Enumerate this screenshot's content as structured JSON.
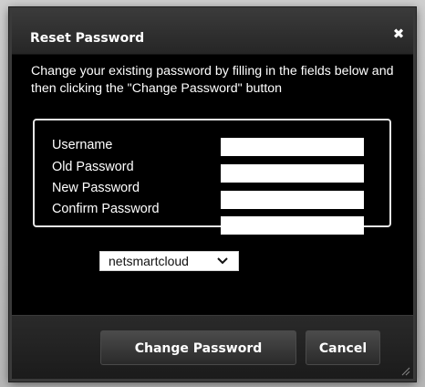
{
  "dialog": {
    "title": "Reset Password",
    "close_symbol": "✖",
    "close_icon": "close-icon",
    "instructions": "Change your existing password by filling in the fields below and then clicking the \"Change Password\" button"
  },
  "fields": [
    {
      "label": "Username",
      "value": ""
    },
    {
      "label": "Old Password",
      "value": ""
    },
    {
      "label": "New Password",
      "value": ""
    },
    {
      "label": "Confirm Password",
      "value": ""
    }
  ],
  "domain_select": {
    "selected": "netsmartcloud",
    "icon": "chevron-down-icon"
  },
  "buttons": {
    "change_password": "Change Password",
    "cancel": "Cancel"
  },
  "colors": {
    "dialog_background": "#000000",
    "titlebar": "#2f2f2f",
    "text": "#ffffff",
    "field_border": "#e6e6e6"
  }
}
